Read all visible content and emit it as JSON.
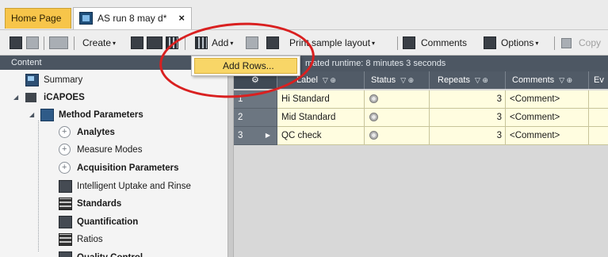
{
  "tabs": {
    "home": "Home Page",
    "document": "AS run 8 may d*",
    "close": "×"
  },
  "toolbar": {
    "create": "Create",
    "add": "Add",
    "print_layout": "Print sample layout",
    "comments": "Comments",
    "options": "Options",
    "copy": "Copy",
    "dropdown_caret": "▾"
  },
  "add_menu": {
    "items": [
      "Add Rows..."
    ]
  },
  "content_panel": {
    "title": "Content",
    "tree": [
      {
        "label": "Summary"
      },
      {
        "label": "iCAPOES"
      },
      {
        "label": "Method Parameters"
      },
      {
        "label": "Analytes"
      },
      {
        "label": "Measure Modes"
      },
      {
        "label": "Acquisition Parameters"
      },
      {
        "label": "Intelligent Uptake and Rinse"
      },
      {
        "label": "Standards"
      },
      {
        "label": "Quantification"
      },
      {
        "label": "Ratios"
      },
      {
        "label": "Quality Control"
      }
    ]
  },
  "info_bar": "mated runtime: 8 minutes 3 seconds",
  "grid": {
    "columns": [
      "Label",
      "Status",
      "Repeats",
      "Comments",
      "Ev"
    ],
    "filter_glyph": "▽ ⊕",
    "rows": [
      {
        "num": "1",
        "label": "Hi Standard",
        "repeats": "3",
        "comment": "<Comment>"
      },
      {
        "num": "2",
        "label": "Mid Standard",
        "repeats": "3",
        "comment": "<Comment>"
      },
      {
        "num": "3",
        "label": "QC check",
        "repeats": "3",
        "comment": "<Comment>"
      }
    ]
  },
  "colors": {
    "home_tab": "#f7c54a",
    "menu_highlight": "#f8d667",
    "header_dark": "#515b67",
    "row_fill": "#fffde0",
    "annotation": "#d92020"
  }
}
